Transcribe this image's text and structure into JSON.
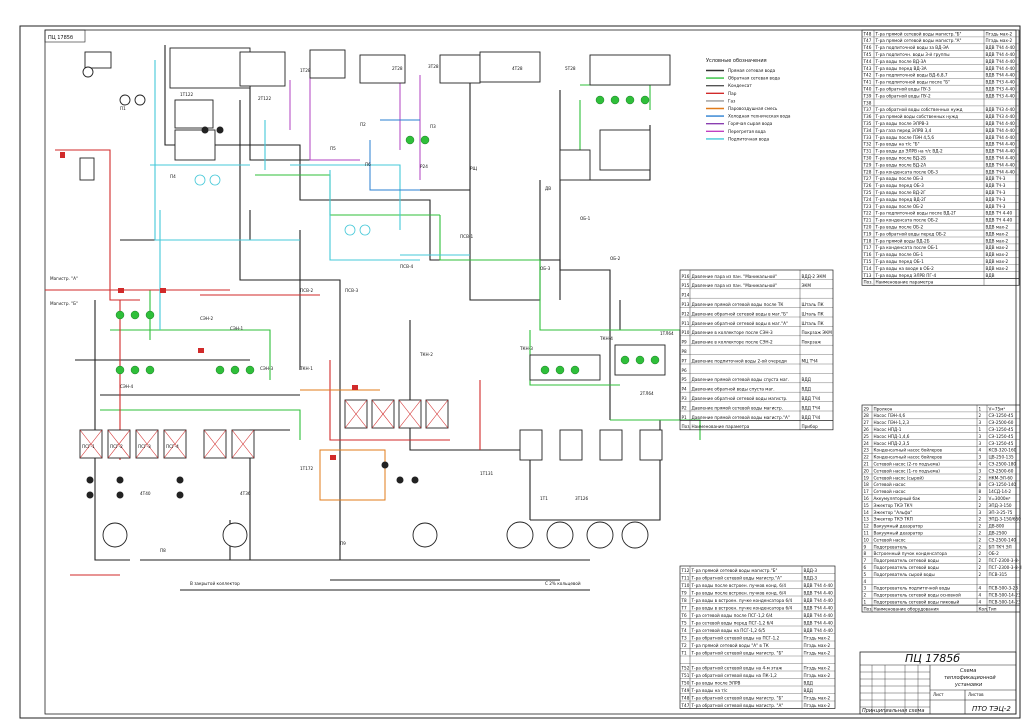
{
  "stamp_top": "ПЦ 1785б",
  "legend": {
    "title": "Условные обозначения",
    "items": [
      {
        "label": "Прямая сетевая вода",
        "color": "#333333"
      },
      {
        "label": "Обратная сетевая вода",
        "color": "#2fbf3a"
      },
      {
        "label": "Конденсат",
        "color": "#555555"
      },
      {
        "label": "Пар",
        "color": "#d12a2a"
      },
      {
        "label": "Газ",
        "color": "#9a9a9a"
      },
      {
        "label": "Паровоздушная смесь",
        "color": "#e07b1a"
      },
      {
        "label": "Холодная техническая вода",
        "color": "#2a7fd1"
      },
      {
        "label": "Горячая сырая вода",
        "color": "#8a3fb0"
      },
      {
        "label": "Перегретая вода",
        "color": "#c040c0"
      },
      {
        "label": "Подпиточная вода",
        "color": "#44c8d8"
      }
    ]
  },
  "table_top_right": {
    "rows": [
      {
        "code": "Т48",
        "desc": "Т-ра прямой сетевой воды магистр.\"Б\"",
        "inst": "Пгздь мах-2"
      },
      {
        "code": "Т47",
        "desc": "Т-ра прямой сетевой воды магистр.\"А\"",
        "inst": "Пгздь мах-2"
      },
      {
        "code": "Т46",
        "desc": "Т-ра подпиточной воды за ВД-ЭА",
        "inst": "ВДВ ТЧ4 4-40"
      },
      {
        "code": "Т45",
        "desc": "Т-ра подпиточн. воды 3-й группы",
        "inst": "ВДВ ТЧ4 4-40"
      },
      {
        "code": "Т44",
        "desc": "Т-ра воды после ВД-3А",
        "inst": "ВДВ ТЧ4 4-40"
      },
      {
        "code": "Т43",
        "desc": "Т-ра воды перед ВД-3А",
        "inst": "ВДВ ТЧ4 4-40"
      },
      {
        "code": "Т42",
        "desc": "Т-ра подпиточной воды ВД-6,8,7",
        "inst": "ВДВ ТЧ4 4-40"
      },
      {
        "code": "Т41",
        "desc": "Т-ра подпиточной воды после \"Б\"",
        "inst": "ВДВ ТЧ3 4-40"
      },
      {
        "code": "Т40",
        "desc": "Т-ра обратной воды ПУ-3",
        "inst": "ВДВ ТЧ3 4-40"
      },
      {
        "code": "Т39",
        "desc": "Т-ра обратной воды ПУ-2",
        "inst": "ВДВ ТЧ3 4-40"
      },
      {
        "code": "Т38",
        "desc": "",
        "inst": ""
      },
      {
        "code": "Т37",
        "desc": "Т-ра обратной воды собственных нужд",
        "inst": "ВДВ ТЧ3 4-40"
      },
      {
        "code": "Т36",
        "desc": "Т-ра прямой воды собственных нужд",
        "inst": "ВДВ ТЧ3 4-40"
      },
      {
        "code": "Т35",
        "desc": "Т-ра воды после ЭЛРВ-3",
        "inst": "ВДВ ТЧ4 4-40"
      },
      {
        "code": "Т34",
        "desc": "Т-ра газа перед ЭЛРВ 3,4",
        "inst": "ВДВ ТЧ4 4-40"
      },
      {
        "code": "Т33",
        "desc": "Т-ра воды после ПЭН 4,5,6",
        "inst": "ВДВ ТЧ4 4-40"
      },
      {
        "code": "Т32",
        "desc": "Т-ра воды на т/с \"Б\"",
        "inst": "ВДВ ТЧ4 4-40"
      },
      {
        "code": "Т31",
        "desc": "Т-ра воды до ЭЛРВ на т/с ВД-2",
        "inst": "ВДВ ТЧ4 4-40"
      },
      {
        "code": "Т30",
        "desc": "Т-ра воды после ВД-2Б",
        "inst": "ВДВ ТЧ4 4-40"
      },
      {
        "code": "Т29",
        "desc": "Т-ра воды после ВД-2А",
        "inst": "ВДВ ТЧ4 4-40"
      },
      {
        "code": "Т28",
        "desc": "Т-ра конденсата после ОБ-3",
        "inst": "ВДВ ТЧ4 4-40"
      },
      {
        "code": "Т27",
        "desc": "Т-ра воды после ОБ-3",
        "inst": "ВДВ ТЧ-3"
      },
      {
        "code": "Т26",
        "desc": "Т-ра воды перед ОБ-3",
        "inst": "ВДВ ТЧ-3"
      },
      {
        "code": "Т25",
        "desc": "Т-ра воды после ВД-2Г",
        "inst": "ВДВ ТЧ-3"
      },
      {
        "code": "Т24",
        "desc": "Т-ра воды перед ВД-2Г",
        "inst": "ВДВ ТЧ-3"
      },
      {
        "code": "Т23",
        "desc": "Т-ра воды после ОБ-2",
        "inst": "ВДВ ТЧ-3"
      },
      {
        "code": "Т22",
        "desc": "Т-ра подпиточной воды после ВД-2Г",
        "inst": "ВДВ ТЧ 4-40"
      },
      {
        "code": "Т21",
        "desc": "Т-ра конденсата после ОБ-2",
        "inst": "ВДВ ТЧ 4-40"
      },
      {
        "code": "Т20",
        "desc": "Т-ра воды после ОБ-2",
        "inst": "ВДВ мах-2"
      },
      {
        "code": "Т19",
        "desc": "Т-ра обратной воды перед ОБ-2",
        "inst": "ВДВ мах-2"
      },
      {
        "code": "Т18",
        "desc": "Т-ра прямой воды ВД-2Б",
        "inst": "ВДВ мах-2"
      },
      {
        "code": "Т17",
        "desc": "Т-ра конденсата после ОБ-1",
        "inst": "ВДВ мах-2"
      },
      {
        "code": "Т16",
        "desc": "Т-ра воды после ОБ-1",
        "inst": "ВДВ мах-2"
      },
      {
        "code": "Т15",
        "desc": "Т-ра воды перед ОБ-1",
        "inst": "ВДВ мах-2"
      },
      {
        "code": "Т14",
        "desc": "Т-ра воды на входе в ОБ-2",
        "inst": "ВДВ мах-2"
      },
      {
        "code": "Т13",
        "desc": "Т-ра воды перед ЭЛРВ ПГ-4",
        "inst": "ВДВ"
      }
    ],
    "footer_code": "Поз.",
    "footer_desc": "Наименование параметра"
  },
  "table_mid_right": {
    "rows": [
      {
        "code": "Р16",
        "desc": "Давление пара из пан. \"Маникальной\"",
        "inst": "ВДД-2 ЭКМ"
      },
      {
        "code": "Р15",
        "desc": "Давление пара из пан. \"Маникальной\"",
        "inst": "ЭКМ"
      },
      {
        "code": "Р14",
        "desc": "",
        "inst": ""
      },
      {
        "code": "Р13",
        "desc": "Давление прямой сетевой воды после ТК",
        "inst": "Шталь ПК"
      },
      {
        "code": "Р12",
        "desc": "Давление обратной сетевой воды в маг.\"Б\"",
        "inst": "Шталь ПК"
      },
      {
        "code": "Р11",
        "desc": "Давление обратной сетевой воды в маг.\"А\"",
        "inst": "Шталь ПК"
      },
      {
        "code": "Р10",
        "desc": "Давление в коллекторе после СЭН-3",
        "inst": "Покрзаж ЭКМ"
      },
      {
        "code": "Р9",
        "desc": "Давление в коллекторе после СЭН-2",
        "inst": "Покрзаж"
      },
      {
        "code": "Р8",
        "desc": "",
        "inst": ""
      },
      {
        "code": "Р7",
        "desc": "Давление подпиточной воды 2-ой очереди",
        "inst": "МЦ ТЧ4"
      },
      {
        "code": "Р6",
        "desc": "",
        "inst": ""
      },
      {
        "code": "Р5",
        "desc": "Давление прямой сетевой воды спуста маг.",
        "inst": "ВДД"
      },
      {
        "code": "Р4",
        "desc": "Давление обратной воды спуста маг.",
        "inst": "ВДД"
      },
      {
        "code": "Р3",
        "desc": "Давление обратной сетевой воды магистр.",
        "inst": "ВДД ТЧ4"
      },
      {
        "code": "Р2",
        "desc": "Давление прямой сетевой воды магистр.",
        "inst": "ВДД ТЧ4"
      },
      {
        "code": "Р1",
        "desc": "Давление прямой сетевой воды магистр.\"А\"",
        "inst": "ВДД ТЧ4"
      }
    ],
    "footer_code": "Поз.",
    "footer_desc": "Наименование параметра",
    "footer_inst": "Прибор"
  },
  "table_equipment": {
    "rows": [
      {
        "n": "29",
        "desc": "Пролкон",
        "qty": "1",
        "type": "V=75м³"
      },
      {
        "n": "28",
        "desc": "Насос ПЭН-4,6",
        "qty": "2",
        "type": "СЭ-1250-45"
      },
      {
        "n": "27",
        "desc": "Насос ПЭН-1,2,3",
        "qty": "3",
        "type": "СЭ-2500-60"
      },
      {
        "n": "26",
        "desc": "Насос НПД-1",
        "qty": "1",
        "type": "СЭ-1250-45"
      },
      {
        "n": "25",
        "desc": "Насос НПД-1,4,6",
        "qty": "3",
        "type": "СЭ-1250-45"
      },
      {
        "n": "24",
        "desc": "Насос НПД-2,3,5",
        "qty": "3",
        "type": "СЭ-1250-45"
      },
      {
        "n": "23",
        "desc": "Конденсатный насос бойлеров",
        "qty": "4",
        "type": "КСВ-320-160"
      },
      {
        "n": "22",
        "desc": "Конденсатный насос бойлеров",
        "qty": "3",
        "type": "ЦВ-250-135"
      },
      {
        "n": "21",
        "desc": "Сетевой насос (2-го подъема)",
        "qty": "4",
        "type": "СЭ-2500-180"
      },
      {
        "n": "20",
        "desc": "Сетевой насос (1-го подъема)",
        "qty": "3",
        "type": "СЭ-2500-60"
      },
      {
        "n": "19",
        "desc": "Сетевой насос (сырой)",
        "qty": "2",
        "type": "НКМ-ЭЛ-60"
      },
      {
        "n": "18",
        "desc": "Сетевой насос",
        "qty": "8",
        "type": "СЭ-1250-140"
      },
      {
        "n": "17",
        "desc": "Сетевой насос",
        "qty": "8",
        "type": "14СД-14-2"
      },
      {
        "n": "16",
        "desc": "Аккумуляторный бак",
        "qty": "2",
        "type": "V=3000м³"
      },
      {
        "n": "15",
        "desc": "Эжектор ТКЭ ТКЧ",
        "qty": "2",
        "type": "ЭПД-3-150"
      },
      {
        "n": "14",
        "desc": "Эжектор \"Альфа\"",
        "qty": "3",
        "type": "ЭП-3-25-75"
      },
      {
        "n": "13",
        "desc": "Эжектор ТКЭ ТКП",
        "qty": "2",
        "type": "ЭПД-3-150/650"
      },
      {
        "n": "12",
        "desc": "Вакуумный деаэратор",
        "qty": "2",
        "type": "ДВ-800"
      },
      {
        "n": "11",
        "desc": "Вакуумный деаэратор",
        "qty": "2",
        "type": "ДВ-2500"
      },
      {
        "n": "10",
        "desc": "Сетевой насос",
        "qty": "2",
        "type": "СЭ-2500-140"
      },
      {
        "n": "9",
        "desc": "Подогреватель",
        "qty": "2",
        "type": "БП ТКЧ ЭЛ"
      },
      {
        "n": "8",
        "desc": "Встроенный пучок конденсатора",
        "qty": "2",
        "type": "ОБ-2"
      },
      {
        "n": "7",
        "desc": "Подогреватель сетевой воды",
        "qty": "2",
        "type": "ПСГ-2300-3-8-I"
      },
      {
        "n": "6",
        "desc": "Подогреватель сетевой воды",
        "qty": "2",
        "type": "ПСГ-2300-3-8-II"
      },
      {
        "n": "5",
        "desc": "Подогреватель сырой воды",
        "qty": "2",
        "type": "ПСВ-315"
      },
      {
        "n": "4",
        "desc": "",
        "qty": "",
        "type": ""
      },
      {
        "n": "3",
        "desc": "Подогреватель подпиточной воды",
        "qty": "4",
        "type": "ПСВ-500-3-23"
      },
      {
        "n": "2",
        "desc": "Подогреватель сетевой воды основной",
        "qty": "4",
        "type": "ПСВ-500-14-23"
      },
      {
        "n": "1",
        "desc": "Подогреватель сетевой воды пиковый",
        "qty": "4",
        "type": "ПСВ-500-14-23"
      }
    ],
    "footer_n": "Поз.",
    "footer_desc": "Наименование оборудования",
    "footer_qty": "Кол.",
    "footer_type": "Тип"
  },
  "table_bottom": {
    "rows": [
      {
        "code": "Т12",
        "desc": "Т-ра прямой сетевой воды магистр.\"Б\"",
        "inst": "ВДД-3"
      },
      {
        "code": "Т11",
        "desc": "Т-ра обратной сетевой воды магистр.\"А\"",
        "inst": "ВДД-3"
      },
      {
        "code": "Т10",
        "desc": "Т-ра воды после встроен. пучков конд. 6/4",
        "inst": "ВДВ ТЧ4 4-40"
      },
      {
        "code": "Т9",
        "desc": "Т-ра воды после встроен. пучков конд. 6/4",
        "inst": "ВДВ ТЧ4 4-40"
      },
      {
        "code": "Т8",
        "desc": "Т-ра воды в встроен. пучке конденсатора 6/4",
        "inst": "ВДВ ТЧ4 4-40"
      },
      {
        "code": "Т7",
        "desc": "Т-ра воды в встроен. пучке конденсатора 6/4",
        "inst": "ВДВ ТЧ4 4-40"
      },
      {
        "code": "Т6",
        "desc": "Т-ра сетевой воды после ПСГ-1,2 6/4",
        "inst": "ВДВ ТЧ4 4-40"
      },
      {
        "code": "Т5",
        "desc": "Т-ра сетевой воды перед ПСГ-1,2 6/4",
        "inst": "ВДВ ТЧ4 4-40"
      },
      {
        "code": "Т4",
        "desc": "Т-ра сетевой воды на ПСГ-1,2 6/5",
        "inst": "ВДВ ТЧ4 4-40"
      },
      {
        "code": "Т3",
        "desc": "Т-ра обратной сетевой воды на ПСГ-1,2",
        "inst": "Пгздь мах-2"
      },
      {
        "code": "Т2",
        "desc": "Т-ра прямой сетевой воды \"А\" в ТК",
        "inst": "Пгздь мах-2"
      },
      {
        "code": "Т1",
        "desc": "Т-ра обратной сетевой воды магистр. \"Б\"",
        "inst": "Пгздь мах-2"
      },
      {
        "code": "",
        "desc": "",
        "inst": ""
      },
      {
        "code": "Т52",
        "desc": "Т-ра обратной сетевой воды на 4-м этаж",
        "inst": "Пгздь мах-2"
      },
      {
        "code": "Т51",
        "desc": "Т-ра обратной сетевой воды на ПК-1,2",
        "inst": "Пгздь мах-2"
      },
      {
        "code": "Т50",
        "desc": "Т-ра воды после ЭЛРВ",
        "inst": "ВДД"
      },
      {
        "code": "Т49",
        "desc": "Т-ра воды на т/с",
        "inst": "ВДД"
      },
      {
        "code": "Т48",
        "desc": "Т-ра обратной сетевой воды магистр. \"Б\"",
        "inst": "Пгздь мах-2"
      },
      {
        "code": "Т47",
        "desc": "Т-ра обратной сетевой воды магистр. \"А\"",
        "inst": "Пгздь мах-2"
      }
    ]
  },
  "title_block": {
    "doc_number": "ПЦ 1785б",
    "title_line1": "Схема",
    "title_line2": "теплофикационной",
    "title_line3": "установки",
    "subtitle": "Принципиальная схема",
    "org": "ПТО ТЭЦ-2",
    "stage_label": "Лист",
    "sheet_label": "Листов"
  },
  "diagram_labels": {
    "equip_psg": [
      "ПСГ-1",
      "ПСГ-2",
      "ПСГ-3",
      "ПСГ-4"
    ],
    "mag_a": "Магистр. \"А\"",
    "mag_b": "Магистр. \"Б\"",
    "bottom_left_note": "В закрытой коллектор",
    "bottom_mid_note": "С 2% кольцевой",
    "valves": [
      "1Т28",
      "2Т28",
      "3Т28",
      "4Т28",
      "5Т28",
      "1Т122",
      "2Т122",
      "П1",
      "П2",
      "П3",
      "П4",
      "П5",
      "П6",
      "Р24",
      "РЩ",
      "ДВ",
      "ОБ-1",
      "ОБ-2",
      "ОБ-3",
      "ПСВ-1",
      "ПСВ-2",
      "ПСВ-3",
      "ПСВ-4",
      "СЭН-1",
      "СЭН-2",
      "СЭН-3",
      "СЭН-4",
      "ТКН-1",
      "ТКН-2",
      "ТКН-3",
      "ТКН-4",
      "1ТЛ64",
      "2ТЛ64",
      "4Т40",
      "4Т36",
      "1Т172",
      "1Т131",
      "1Т1",
      "3Т126",
      "П8",
      "П9"
    ]
  }
}
